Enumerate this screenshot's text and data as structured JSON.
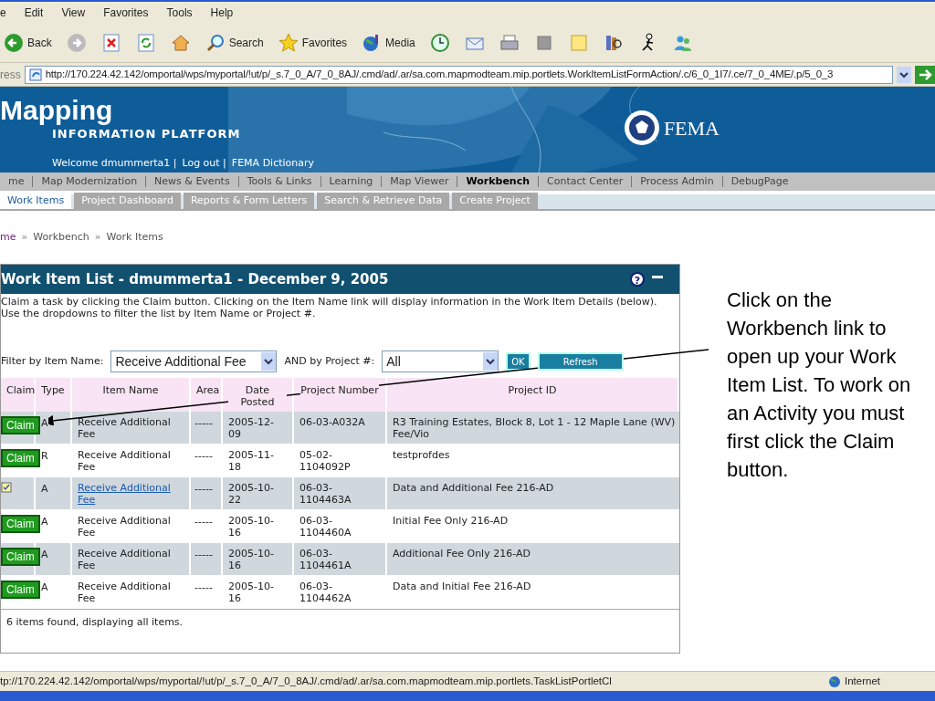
{
  "menu_bar": [
    "e",
    "Edit",
    "View",
    "Favorites",
    "Tools",
    "Help"
  ],
  "toolbar": [
    {
      "kind": "back",
      "label": "Back"
    },
    {
      "kind": "forward"
    },
    {
      "kind": "stop"
    },
    {
      "kind": "refresh"
    },
    {
      "kind": "home"
    },
    {
      "kind": "search",
      "label": "Search"
    },
    {
      "kind": "favorites",
      "label": "Favorites"
    },
    {
      "kind": "media",
      "label": "Media"
    },
    {
      "kind": "history"
    },
    {
      "kind": "mail"
    },
    {
      "kind": "print"
    },
    {
      "kind": "edit"
    },
    {
      "kind": "note"
    },
    {
      "kind": "research"
    },
    {
      "kind": "messenger"
    },
    {
      "kind": "contacts"
    }
  ],
  "address": {
    "label": "ress",
    "url": "http://170.224.42.142/omportal/wps/myportal/!ut/p/_s.7_0_A/7_0_8AJ/.cmd/ad/.ar/sa.com.mapmodteam.mip.portlets.WorkItemListFormAction/.c/6_0_1I7/.ce/7_0_4ME/.p/5_0_3"
  },
  "banner": {
    "title": "Mapping",
    "subtitle": "INFORMATION PLATFORM",
    "links": [
      "Welcome dmummerta1 |",
      "Log out |",
      "FEMA Dictionary"
    ],
    "agency": "FEMA"
  },
  "nav": [
    {
      "label": "me",
      "selected": false
    },
    {
      "label": "Map Modernization",
      "selected": false
    },
    {
      "label": "News & Events",
      "selected": false
    },
    {
      "label": "Tools & Links",
      "selected": false
    },
    {
      "label": "Learning",
      "selected": false
    },
    {
      "label": "Map Viewer",
      "selected": false
    },
    {
      "label": "Workbench",
      "selected": true
    },
    {
      "label": "Contact Center",
      "selected": false
    },
    {
      "label": "Process Admin",
      "selected": false
    },
    {
      "label": "DebugPage",
      "selected": false
    }
  ],
  "subtabs": [
    {
      "label": "Work Items",
      "selected": true
    },
    {
      "label": "Project Dashboard",
      "selected": false
    },
    {
      "label": "Reports & Form Letters",
      "selected": false
    },
    {
      "label": "Search & Retrieve Data",
      "selected": false
    },
    {
      "label": "Create Project",
      "selected": false
    }
  ],
  "breadcrumb": [
    {
      "kind": "link",
      "text": "me"
    },
    {
      "kind": "sep",
      "text": "»"
    },
    {
      "kind": "text",
      "text": "Workbench"
    },
    {
      "kind": "sep",
      "text": "»"
    },
    {
      "kind": "text",
      "text": "Work Items"
    }
  ],
  "portlet": {
    "title": "Work Item List - dmummerta1 - December 9, 2005",
    "help": "?",
    "description": "Claim a task by clicking the Claim button. Clicking on the Item Name link will display information in the Work Item Details (below). Use the dropdowns to filter the list by Item Name or Project #.",
    "filter_label": "Filter by Item Name:",
    "item_select": "Receive Additional Fee",
    "project_label": "AND by Project #:",
    "project_select": "All",
    "ok": "OK",
    "refresh": "Refresh",
    "columns": [
      "Claim",
      "Type",
      "Item Name",
      "Area",
      "Date Posted",
      "Project Number",
      "Project ID"
    ],
    "rows": [
      {
        "kind": "claim",
        "claim": "Claim",
        "type": "A",
        "item": "Receive Additional Fee",
        "link": false,
        "area": "-----",
        "date": "2005-12-09",
        "number": "06-03-A032A",
        "project": "R3 Training Estates, Block 8, Lot 1 - 12 Maple Lane (WV) Fee/Vio"
      },
      {
        "kind": "claim",
        "claim": "Claim",
        "type": "R",
        "item": "Receive Additional Fee",
        "link": false,
        "area": "-----",
        "date": "2005-11-18",
        "number": "05-02-1104092P",
        "project": "testprofdes"
      },
      {
        "kind": "claimed",
        "type": "A",
        "item": "Receive Additional Fee",
        "link": true,
        "area": "-----",
        "date": "2005-10-22",
        "number": "06-03-1104463A",
        "project": "Data and Additional Fee 216-AD"
      },
      {
        "kind": "claim",
        "claim": "Claim",
        "type": "A",
        "item": "Receive Additional Fee",
        "link": false,
        "area": "-----",
        "date": "2005-10-16",
        "number": "06-03-1104460A",
        "project": "Initial Fee Only 216-AD"
      },
      {
        "kind": "claim",
        "claim": "Claim",
        "type": "A",
        "item": "Receive Additional Fee",
        "link": false,
        "area": "-----",
        "date": "2005-10-16",
        "number": "06-03-1104461A",
        "project": "Additional Fee Only 216-AD"
      },
      {
        "kind": "claim",
        "claim": "Claim",
        "type": "A",
        "item": "Receive Additional Fee",
        "link": false,
        "area": "-----",
        "date": "2005-10-16",
        "number": "06-03-1104462A",
        "project": "Data and Initial Fee 216-AD"
      }
    ],
    "footer": "6 items found, displaying all items."
  },
  "status_bar": {
    "url": "tp://170.224.42.142/omportal/wps/myportal/!ut/p/_s.7_0_A/7_0_8AJ/.cmd/ad/.ar/sa.com.mapmodteam.mip.portlets.TaskListPortletCl",
    "zone": "Internet"
  },
  "callout": "Click on the Workbench link to open up your Work Item List. To work on an Activity you must first click the Claim button."
}
